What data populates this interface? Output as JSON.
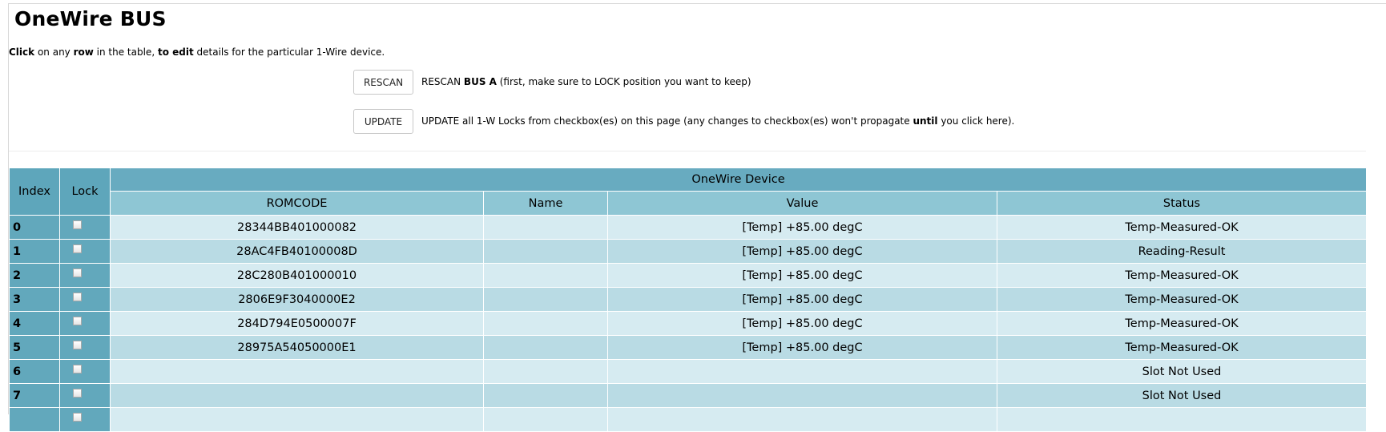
{
  "page": {
    "title": "OneWire BUS",
    "intro": {
      "click": "Click",
      "t1": " on any ",
      "row": "row",
      "t2": " in the table, ",
      "to_edit": "to edit",
      "t3": " details for the particular 1-Wire device."
    }
  },
  "actions": {
    "rescan": {
      "label": "RESCAN",
      "desc_a": "RESCAN ",
      "desc_bold": "BUS A",
      "desc_b": " (first, make sure to LOCK position you want to keep)"
    },
    "update": {
      "label": "UPDATE",
      "desc_a": "UPDATE all 1-W Locks from checkbox(es) on this page (any changes to checkbox(es) won't propagate ",
      "desc_bold": "until",
      "desc_b": " you click here)."
    }
  },
  "table": {
    "headers": {
      "index": "Index",
      "lock": "Lock",
      "group": "OneWire Device",
      "romcode": "ROMCODE",
      "name": "Name",
      "value": "Value",
      "status": "Status"
    },
    "rows": [
      {
        "index": "0",
        "locked": false,
        "romcode": "28344BB401000082",
        "name": "",
        "value": "[Temp] +85.00 degC",
        "status": "Temp-Measured-OK"
      },
      {
        "index": "1",
        "locked": false,
        "romcode": "28AC4FB40100008D",
        "name": "",
        "value": "[Temp] +85.00 degC",
        "status": "Reading-Result"
      },
      {
        "index": "2",
        "locked": false,
        "romcode": "28C280B401000010",
        "name": "",
        "value": "[Temp] +85.00 degC",
        "status": "Temp-Measured-OK"
      },
      {
        "index": "3",
        "locked": false,
        "romcode": "2806E9F3040000E2",
        "name": "",
        "value": "[Temp] +85.00 degC",
        "status": "Temp-Measured-OK"
      },
      {
        "index": "4",
        "locked": false,
        "romcode": "284D794E0500007F",
        "name": "",
        "value": "[Temp] +85.00 degC",
        "status": "Temp-Measured-OK"
      },
      {
        "index": "5",
        "locked": false,
        "romcode": "28975A54050000E1",
        "name": "",
        "value": "[Temp] +85.00 degC",
        "status": "Temp-Measured-OK"
      },
      {
        "index": "6",
        "locked": false,
        "romcode": "",
        "name": "",
        "value": "",
        "status": "Slot Not Used"
      },
      {
        "index": "7",
        "locked": false,
        "romcode": "",
        "name": "",
        "value": "",
        "status": "Slot Not Used"
      },
      {
        "index": "",
        "locked": false,
        "romcode": "",
        "name": "",
        "value": "",
        "status": ""
      }
    ]
  }
}
